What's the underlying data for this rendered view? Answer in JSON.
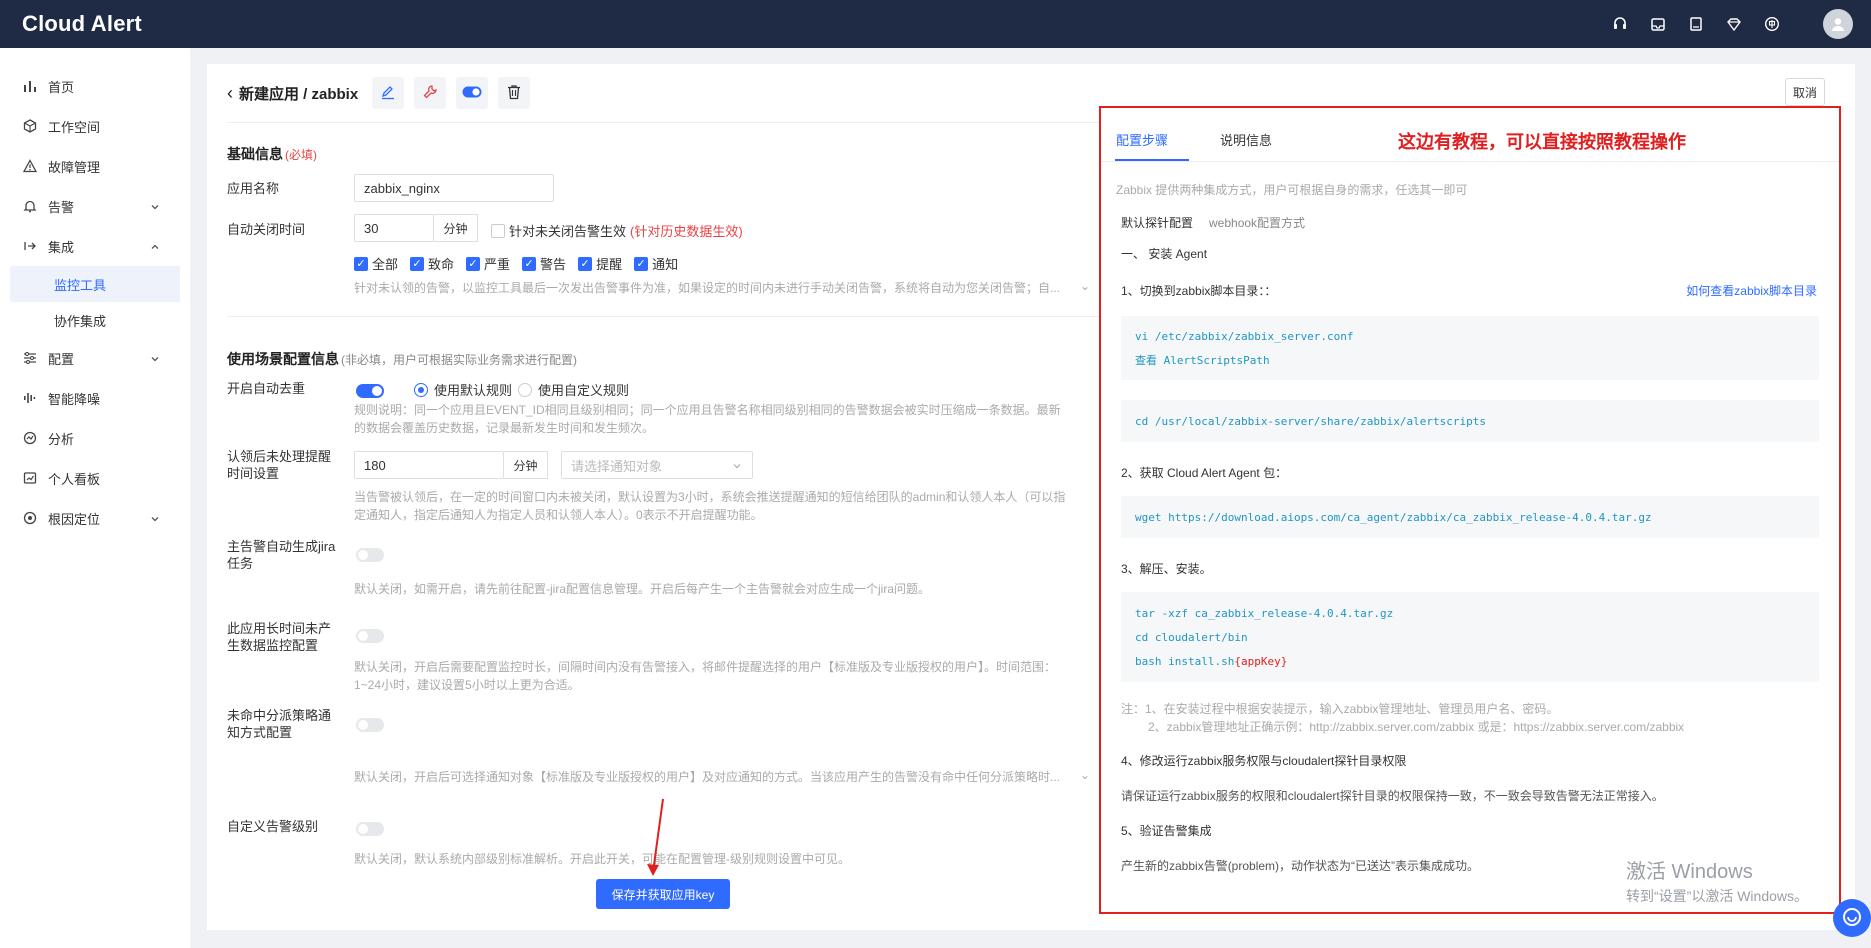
{
  "app": {
    "title": "Cloud Alert"
  },
  "topbar": {
    "icons": [
      "headset-icon",
      "inbox-icon",
      "book-icon",
      "diamond-icon",
      "language-icon"
    ]
  },
  "sidebar": {
    "items": [
      {
        "label": "首页",
        "icon": "bar-chart-icon"
      },
      {
        "label": "工作空间",
        "icon": "cube-icon"
      },
      {
        "label": "故障管理",
        "icon": "warning-icon"
      },
      {
        "label": "告警",
        "icon": "bell-icon",
        "chevron": "down"
      },
      {
        "label": "集成",
        "icon": "integration-icon",
        "chevron": "up"
      },
      {
        "label": "配置",
        "icon": "sliders-icon",
        "chevron": "down"
      },
      {
        "label": "智能降噪",
        "icon": "equalizer-icon"
      },
      {
        "label": "分析",
        "icon": "analysis-icon"
      },
      {
        "label": "个人看板",
        "icon": "dashboard-icon"
      },
      {
        "label": "根因定位",
        "icon": "target-icon",
        "chevron": "down"
      }
    ],
    "sub_items": [
      {
        "label": "监控工具",
        "active": true
      },
      {
        "label": "协作集成",
        "active": false
      }
    ]
  },
  "header": {
    "breadcrumb": "新建应用 / zabbix",
    "cancel_label": "取消"
  },
  "basic": {
    "title": "基础信息",
    "required": "(必填)",
    "app_name_label": "应用名称",
    "app_name_value": "zabbix_nginx",
    "auto_close_label": "自动关闭时间",
    "auto_close_value": "30",
    "auto_close_unit": "分钟",
    "unclosed_label": "针对未关闭告警生效",
    "unclosed_note": "(针对历史数据生效)",
    "levels": [
      "全部",
      "致命",
      "严重",
      "警告",
      "提醒",
      "通知"
    ],
    "auto_close_desc": "针对未认领的告警，以监控工具最后一次发出告警事件为准，如果设定的时间内未进行手动关闭告警，系统将自动为您关闭告警；自..."
  },
  "scene": {
    "title": "使用场景配置信息",
    "hint": "(非必填，用户可根据实际业务需求进行配置)",
    "dedup_label": "开启自动去重",
    "dedup_on": true,
    "radio_default": "使用默认规则",
    "radio_custom": "使用自定义规则",
    "dedup_desc": "规则说明：同一个应用且EVENT_ID相同且级别相同；同一个应用且告警名称相同级别相同的告警数据会被实时压缩成一条数据。最新的数据会覆盖历史数据，记录最新发生时间和发生频次。",
    "remind_label": "认领后未处理提醒时间设置",
    "remind_value": "180",
    "remind_unit": "分钟",
    "remind_placeholder": "请选择通知对象",
    "remind_desc": "当告警被认领后，在一定的时间窗口内未被关闭，默认设置为3小时，系统会推送提醒通知的短信给团队的admin和认领人本人（可以指定通知人，指定后通知人为指定人员和认领人本人）。0表示不开启提醒功能。",
    "jira_label": "主告警自动生成jira任务",
    "jira_on": false,
    "jira_desc": "默认关闭，如需开启，请先前往配置-jira配置信息管理。开启后每产生一个主告警就会对应生成一个jira问题。",
    "nodata_label": "此应用长时间未产生数据监控配置",
    "nodata_on": false,
    "nodata_desc": "默认关闭，开启后需要配置监控时长，间隔时间内没有告警接入，将邮件提醒选择的用户【标准版及专业版授权的用户】。时间范围：1~24小时，建议设置5小时以上更为合适。",
    "dispatch_label": "未命中分派策略通知方式配置",
    "dispatch_on": false,
    "dispatch_desc": "默认关闭，开启后可选择通知对象【标准版及专业版授权的用户】及对应通知的方式。当该应用产生的告警没有命中任何分派策略时...",
    "level_label": "自定义告警级别",
    "level_on": false,
    "level_desc": "默认关闭，默认系统内部级别标准解析。开启此开关，可能在配置管理-级别规则设置中可见。"
  },
  "save_label": "保存并获取应用key",
  "panel": {
    "tabs": [
      "配置步骤",
      "说明信息"
    ],
    "annotation": "这边有教程，可以直接按照教程操作",
    "intro": "Zabbix 提供两种集成方式，用户可根据自身的需求，任选其一即可",
    "sub_tabs": [
      "默认探针配置",
      "webhook配置方式"
    ],
    "step_install": "一、 安装 Agent",
    "step1": "1、切换到zabbix脚本目录：：",
    "step1_link": "如何查看zabbix脚本目录",
    "code1": [
      "vi /etc/zabbix/zabbix_server.conf",
      "查看 AlertScriptsPath"
    ],
    "code2": "cd /usr/local/zabbix-server/share/zabbix/alertscripts",
    "step2": "2、获取 Cloud Alert Agent 包：",
    "code3": "wget https://download.aiops.com/ca_agent/zabbix/ca_zabbix_release-4.0.4.tar.gz",
    "step3": "3、解压、安装。",
    "code4": [
      "tar -xzf ca_zabbix_release-4.0.4.tar.gz",
      "cd cloudalert/bin",
      "bash install.sh "
    ],
    "code4_key": "{appKey}",
    "note1": "注：1、在安装过程中根据安装提示，输入zabbix管理地址、管理员用户名、密码。",
    "note2": "2、zabbix管理地址正确示例：http://zabbix.server.com/zabbix 或是：https://zabbix.server.com/zabbix",
    "step4": "4、修改运行zabbix服务权限与cloudalert探针目录权限",
    "step4_desc": "请保证运行zabbix服务的权限和cloudalert探针目录的权限保持一致，不一致会导致告警无法正常接入。",
    "step5": "5、验证告警集成",
    "step5_desc": "产生新的zabbix告警(problem)，动作状态为“已送达”表示集成成功。"
  },
  "watermark": {
    "line1": "激活 Windows",
    "line2": "转到“设置”以激活 Windows。"
  },
  "colors": {
    "primary": "#2f6bff",
    "topbar": "#1f2a44",
    "annotation": "#e02020"
  }
}
